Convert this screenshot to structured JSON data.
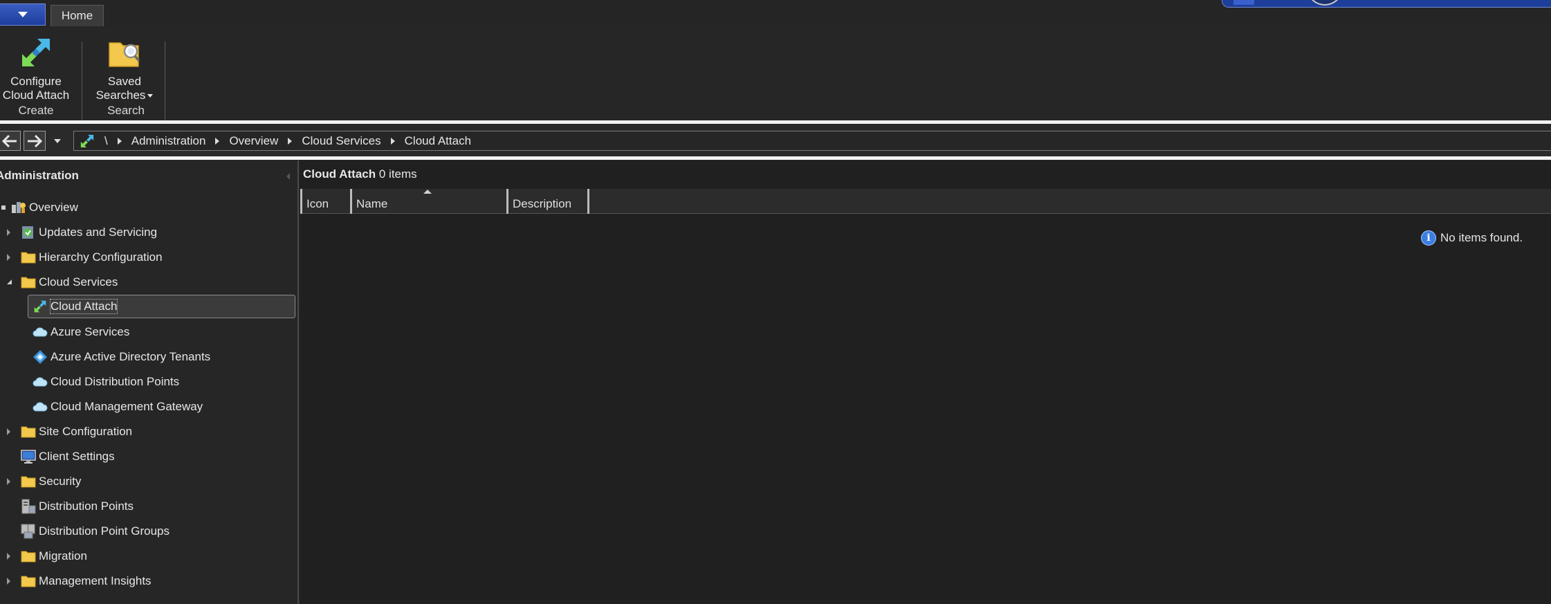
{
  "tabs": {
    "home": "Home"
  },
  "ribbon": {
    "configure_line1": "Configure",
    "configure_line2": "Cloud Attach",
    "saved_line1": "Saved",
    "saved_line2": "Searches",
    "group_create": "Create",
    "group_search": "Search"
  },
  "address": {
    "root": "\\",
    "crumbs": [
      "Administration",
      "Overview",
      "Cloud Services",
      "Cloud Attach"
    ]
  },
  "nav": {
    "header": "Administration",
    "items": [
      {
        "label": "Overview",
        "icon": "overview-icon"
      },
      {
        "label": "Updates and Servicing",
        "icon": "updates-icon"
      },
      {
        "label": "Hierarchy Configuration",
        "icon": "folder-icon"
      },
      {
        "label": "Cloud Services",
        "icon": "folder-icon"
      },
      {
        "label": "Cloud Attach",
        "icon": "cloud-attach-icon"
      },
      {
        "label": "Azure Services",
        "icon": "cloud-icon"
      },
      {
        "label": "Azure Active Directory Tenants",
        "icon": "azure-ad-icon"
      },
      {
        "label": "Cloud Distribution Points",
        "icon": "cloud-icon"
      },
      {
        "label": "Cloud Management Gateway",
        "icon": "cloud-icon"
      },
      {
        "label": "Site Configuration",
        "icon": "folder-icon"
      },
      {
        "label": "Client Settings",
        "icon": "monitor-icon"
      },
      {
        "label": "Security",
        "icon": "folder-icon"
      },
      {
        "label": "Distribution Points",
        "icon": "server-icon"
      },
      {
        "label": "Distribution Point Groups",
        "icon": "server-group-icon"
      },
      {
        "label": "Migration",
        "icon": "folder-icon"
      },
      {
        "label": "Management Insights",
        "icon": "folder-icon"
      }
    ]
  },
  "main": {
    "title": "Cloud Attach",
    "count": "0 items",
    "columns": [
      "Icon",
      "Name",
      "Description"
    ],
    "empty_message": "No items found."
  },
  "colors": {
    "background": "#252525",
    "accent_blue": "#1e3f9e",
    "folder_yellow": "#f2c94c",
    "info_blue": "#3d7fe0"
  }
}
